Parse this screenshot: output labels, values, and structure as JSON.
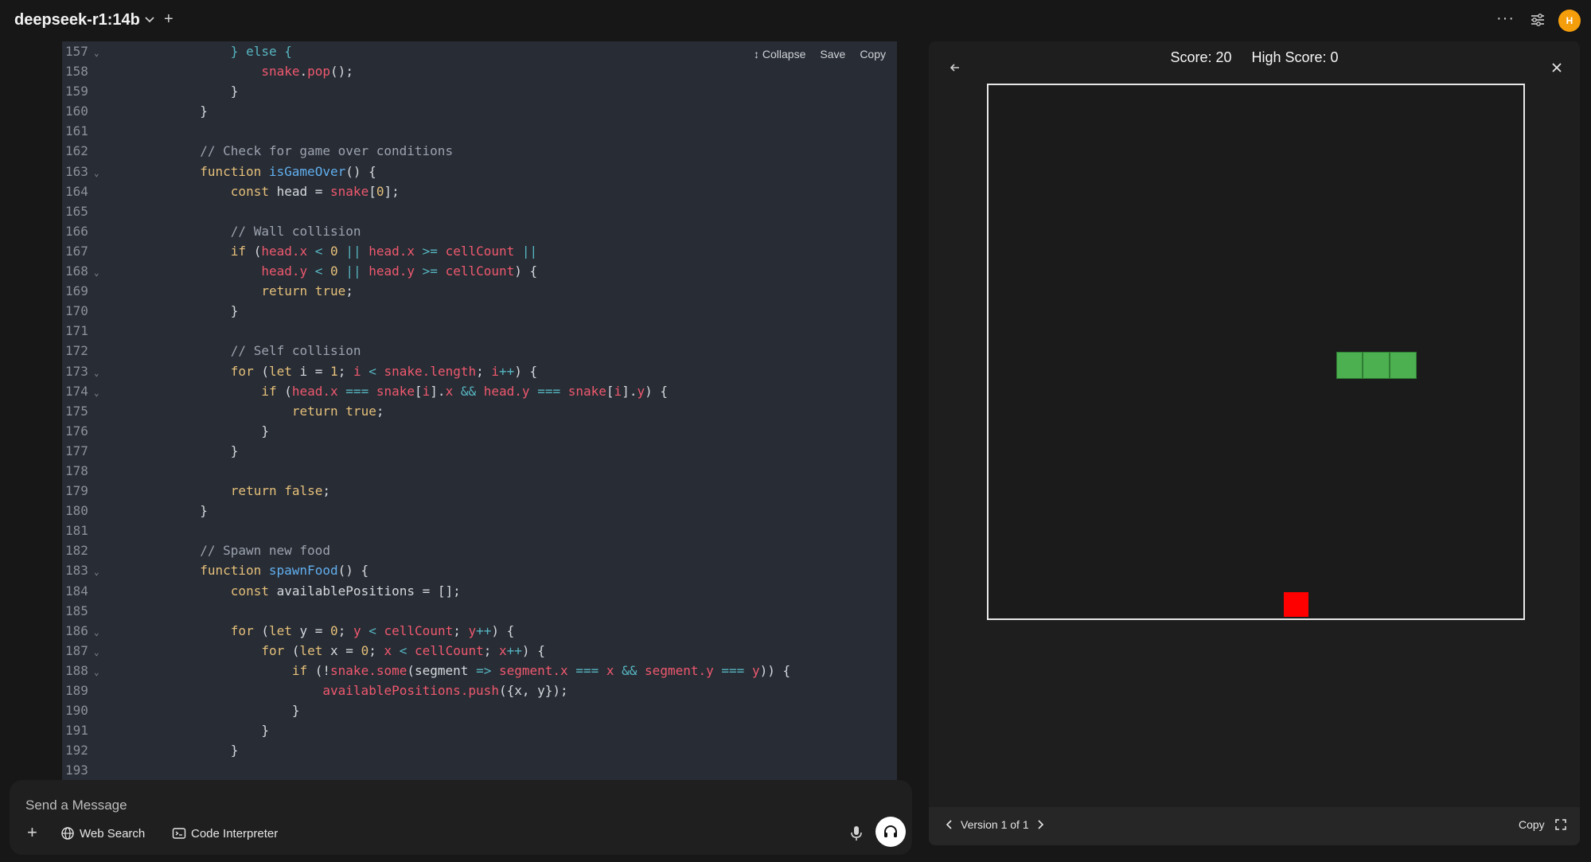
{
  "topbar": {
    "model_name": "deepseek-r1:14b",
    "avatar_initial": "H"
  },
  "code_panel": {
    "toolbar": {
      "collapse": "Collapse",
      "save": "Save",
      "copy": "Copy"
    },
    "lines": [
      {
        "n": "157",
        "fold": true,
        "html": "<span class='tok-op'>} else {</span>"
      },
      {
        "n": "158",
        "fold": false,
        "html": "    <span class='tok-var'>snake</span>.<span class='tok-var'>pop</span>();"
      },
      {
        "n": "159",
        "fold": false,
        "html": "}"
      },
      {
        "n": "160",
        "fold": false,
        "html": "}",
        "indent": -4
      },
      {
        "n": "161",
        "fold": false,
        "html": ""
      },
      {
        "n": "162",
        "fold": false,
        "html": "<span class='tok-cm'>// Check for game over conditions</span>",
        "indent": -4
      },
      {
        "n": "163",
        "fold": true,
        "html": "<span class='tok-kw'>function</span> <span class='tok-fn'>isGameOver</span>() {",
        "indent": -4
      },
      {
        "n": "164",
        "fold": false,
        "html": "<span class='tok-kw'>const</span> head = <span class='tok-var'>snake</span>[<span class='tok-num'>0</span>];"
      },
      {
        "n": "165",
        "fold": false,
        "html": ""
      },
      {
        "n": "166",
        "fold": false,
        "html": "<span class='tok-cm'>// Wall collision</span>"
      },
      {
        "n": "167",
        "fold": false,
        "html": "<span class='tok-kw'>if</span> (<span class='tok-var'>head.x</span> <span class='tok-op'>&lt;</span> <span class='tok-num'>0</span> <span class='tok-op'>||</span> <span class='tok-var'>head.x</span> <span class='tok-op'>&gt;=</span> <span class='tok-var'>cellCount</span> <span class='tok-op'>||</span>"
      },
      {
        "n": "168",
        "fold": true,
        "html": "    <span class='tok-var'>head.y</span> <span class='tok-op'>&lt;</span> <span class='tok-num'>0</span> <span class='tok-op'>||</span> <span class='tok-var'>head.y</span> <span class='tok-op'>&gt;=</span> <span class='tok-var'>cellCount</span>) {"
      },
      {
        "n": "169",
        "fold": false,
        "html": "    <span class='tok-kw'>return</span> <span class='tok-num'>true</span>;"
      },
      {
        "n": "170",
        "fold": false,
        "html": "}"
      },
      {
        "n": "171",
        "fold": false,
        "html": ""
      },
      {
        "n": "172",
        "fold": false,
        "html": "<span class='tok-cm'>// Self collision</span>"
      },
      {
        "n": "173",
        "fold": true,
        "html": "<span class='tok-kw'>for</span> (<span class='tok-kw'>let</span> i = <span class='tok-num'>1</span>; <span class='tok-var'>i</span> <span class='tok-op'>&lt;</span> <span class='tok-var'>snake.length</span>; <span class='tok-var'>i</span><span class='tok-op'>++</span>) {"
      },
      {
        "n": "174",
        "fold": true,
        "html": "    <span class='tok-kw'>if</span> (<span class='tok-var'>head.x</span> <span class='tok-op'>===</span> <span class='tok-var'>snake</span>[<span class='tok-var'>i</span>].<span class='tok-var'>x</span> <span class='tok-op'>&amp;&amp;</span> <span class='tok-var'>head.y</span> <span class='tok-op'>===</span> <span class='tok-var'>snake</span>[<span class='tok-var'>i</span>].<span class='tok-var'>y</span>) {"
      },
      {
        "n": "175",
        "fold": false,
        "html": "        <span class='tok-kw'>return</span> <span class='tok-num'>true</span>;"
      },
      {
        "n": "176",
        "fold": false,
        "html": "    }"
      },
      {
        "n": "177",
        "fold": false,
        "html": "}"
      },
      {
        "n": "178",
        "fold": false,
        "html": ""
      },
      {
        "n": "179",
        "fold": false,
        "html": "<span class='tok-kw'>return</span> <span class='tok-num'>false</span>;"
      },
      {
        "n": "180",
        "fold": false,
        "html": "}",
        "indent": -4
      },
      {
        "n": "181",
        "fold": false,
        "html": ""
      },
      {
        "n": "182",
        "fold": false,
        "html": "<span class='tok-cm'>// Spawn new food</span>",
        "indent": -4
      },
      {
        "n": "183",
        "fold": true,
        "html": "<span class='tok-kw'>function</span> <span class='tok-fn'>spawnFood</span>() {",
        "indent": -4
      },
      {
        "n": "184",
        "fold": false,
        "html": "<span class='tok-kw'>const</span> availablePositions = [];"
      },
      {
        "n": "185",
        "fold": false,
        "html": ""
      },
      {
        "n": "186",
        "fold": true,
        "html": "<span class='tok-kw'>for</span> (<span class='tok-kw'>let</span> y = <span class='tok-num'>0</span>; <span class='tok-var'>y</span> <span class='tok-op'>&lt;</span> <span class='tok-var'>cellCount</span>; <span class='tok-var'>y</span><span class='tok-op'>++</span>) {"
      },
      {
        "n": "187",
        "fold": true,
        "html": "    <span class='tok-kw'>for</span> (<span class='tok-kw'>let</span> x = <span class='tok-num'>0</span>; <span class='tok-var'>x</span> <span class='tok-op'>&lt;</span> <span class='tok-var'>cellCount</span>; <span class='tok-var'>x</span><span class='tok-op'>++</span>) {"
      },
      {
        "n": "188",
        "fold": true,
        "html": "        <span class='tok-kw'>if</span> (!<span class='tok-var'>snake.some</span>(segment <span class='tok-op'>=&gt;</span> <span class='tok-var'>segment.x</span> <span class='tok-op'>===</span> <span class='tok-var'>x</span> <span class='tok-op'>&amp;&amp;</span> <span class='tok-var'>segment.y</span> <span class='tok-op'>===</span> <span class='tok-var'>y</span>)) {"
      },
      {
        "n": "189",
        "fold": false,
        "html": "            <span class='tok-var'>availablePositions.push</span>({x, y});"
      },
      {
        "n": "190",
        "fold": false,
        "html": "        }"
      },
      {
        "n": "191",
        "fold": false,
        "html": "    }"
      },
      {
        "n": "192",
        "fold": false,
        "html": "}"
      },
      {
        "n": "193",
        "fold": false,
        "html": ""
      }
    ]
  },
  "composer": {
    "placeholder": "Send a Message",
    "web_search": "Web Search",
    "code_interpreter": "Code Interpreter"
  },
  "preview": {
    "score_label": "Score: 20",
    "high_score_label": "High Score: 0",
    "version_label": "Version 1 of 1",
    "copy_label": "Copy",
    "game": {
      "grid_cells": 20,
      "snake": [
        [
          13,
          10
        ],
        [
          14,
          10
        ],
        [
          15,
          10
        ]
      ],
      "food": [
        11,
        19
      ]
    }
  },
  "colors": {
    "background": "#171717",
    "code_bg": "#282c34",
    "snake": "#4caf50",
    "food": "#ff0000",
    "avatar": "#f59e0b"
  }
}
